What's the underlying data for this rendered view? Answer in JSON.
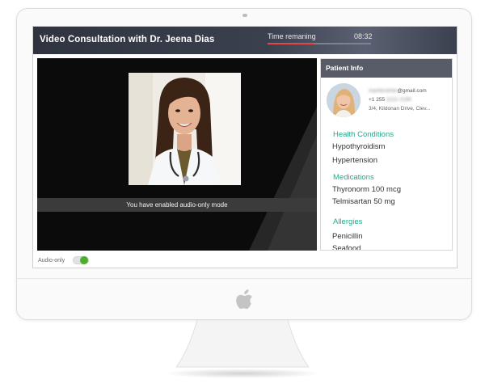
{
  "header": {
    "title": "Video Consultation with Dr. Jeena Dias",
    "time_label": "Time remaning",
    "time_value": "08:32",
    "time_progress": 0.45
  },
  "video": {
    "banner": "You have enabled audio-only mode"
  },
  "audio_toggle": {
    "label": "Audio-only",
    "on": true
  },
  "panel": {
    "title": "Patient Info",
    "patient": {
      "email_hidden": "mariterwhite",
      "email_domain": "@gmail.com",
      "phone_prefix": "+1 255",
      "phone_hidden": "2222 2199",
      "address": "3/4, Kildonan Drive, Clev..."
    },
    "sections": [
      {
        "title": "Health Conditions",
        "items": [
          "Hypothyroidism",
          "Hypertension"
        ]
      },
      {
        "title": "Medications",
        "items": [
          "Thyronorm 100 mcg",
          "Telmisartan 50 mg"
        ]
      },
      {
        "title": "Allergies",
        "items": [
          "Penicillin",
          "Seafood"
        ]
      }
    ]
  },
  "colors": {
    "accent_teal": "#23a98c",
    "progress_red": "#e8473f",
    "toggle_green": "#4caf2a",
    "header_dark": "#2f3440"
  }
}
